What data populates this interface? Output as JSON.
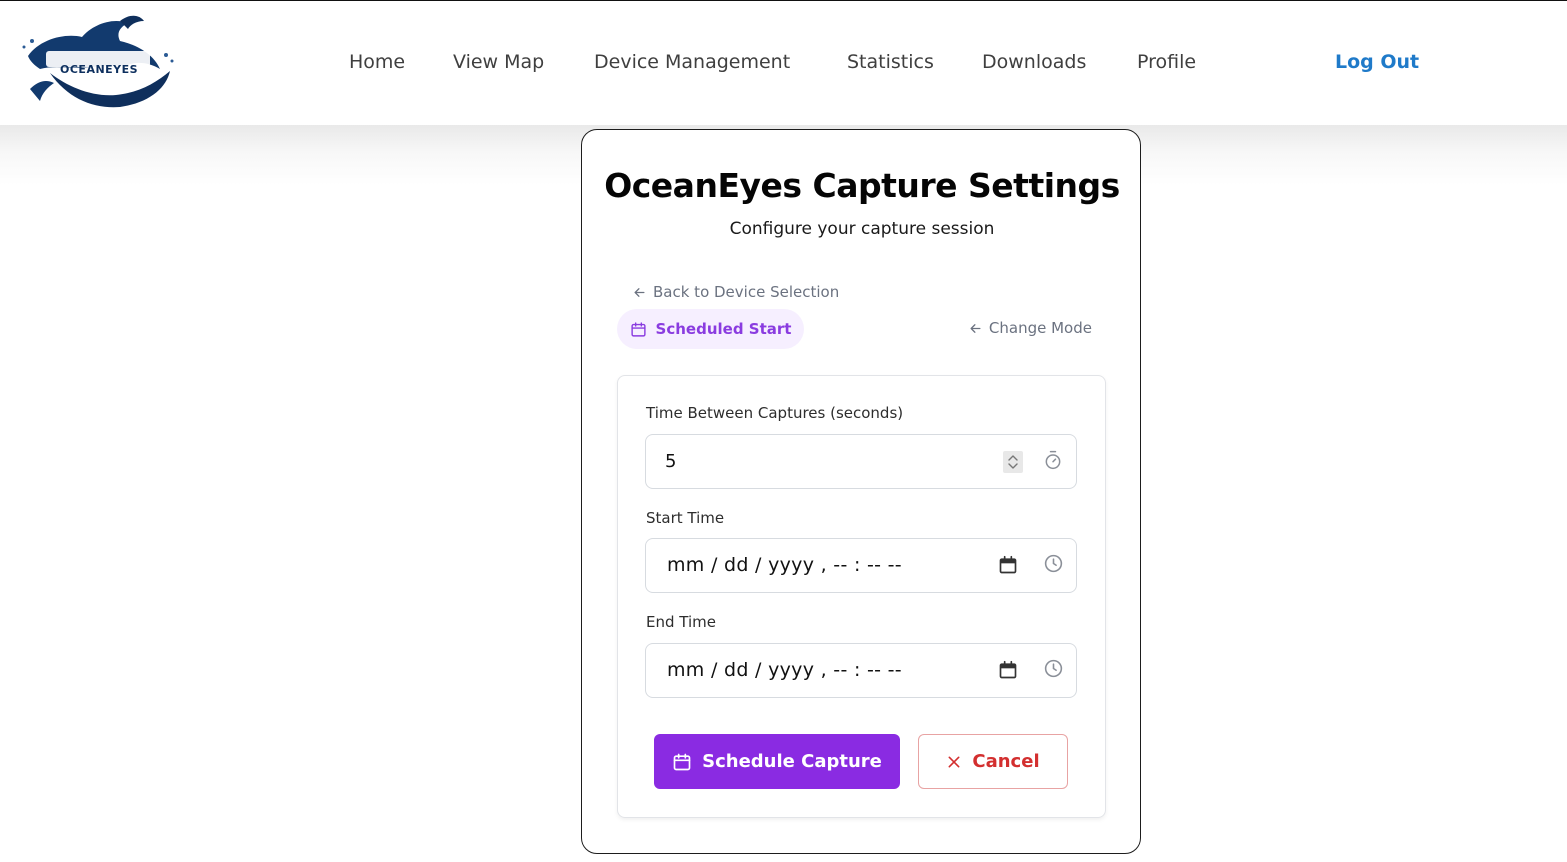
{
  "brand": {
    "logo_text": "OCEANEYES"
  },
  "nav": {
    "home": "Home",
    "view_map": "View Map",
    "device_management": "Device Management",
    "statistics": "Statistics",
    "downloads": "Downloads",
    "profile": "Profile",
    "logout": "Log Out"
  },
  "card": {
    "title": "OceanEyes Capture Settings",
    "subtitle": "Configure your capture session",
    "back_link": "Back to Device Selection",
    "mode_label": "Scheduled Start",
    "change_mode": "Change Mode"
  },
  "form": {
    "interval_label": "Time Between Captures (seconds)",
    "interval_value": "5",
    "start_label": "Start Time",
    "start_value": "mm / dd / yyyy ,  -- : --   --",
    "end_label": "End Time",
    "end_value": "mm / dd / yyyy ,  -- : --   --",
    "schedule_button": "Schedule Capture",
    "cancel_button": "Cancel"
  },
  "colors": {
    "accent_purple": "#8a2be2",
    "logout_blue": "#1f7ac9",
    "cancel_red": "#d32f2f",
    "pill_bg": "#f6efff"
  },
  "icons": {
    "logo": "whale-logo-icon",
    "back": "arrow-left-icon",
    "mode": "calendar-icon",
    "change_mode": "arrow-left-icon",
    "interval": "timer-icon",
    "date_picker": "calendar-icon",
    "time_picker": "clock-icon",
    "schedule": "calendar-icon",
    "cancel": "close-icon"
  }
}
